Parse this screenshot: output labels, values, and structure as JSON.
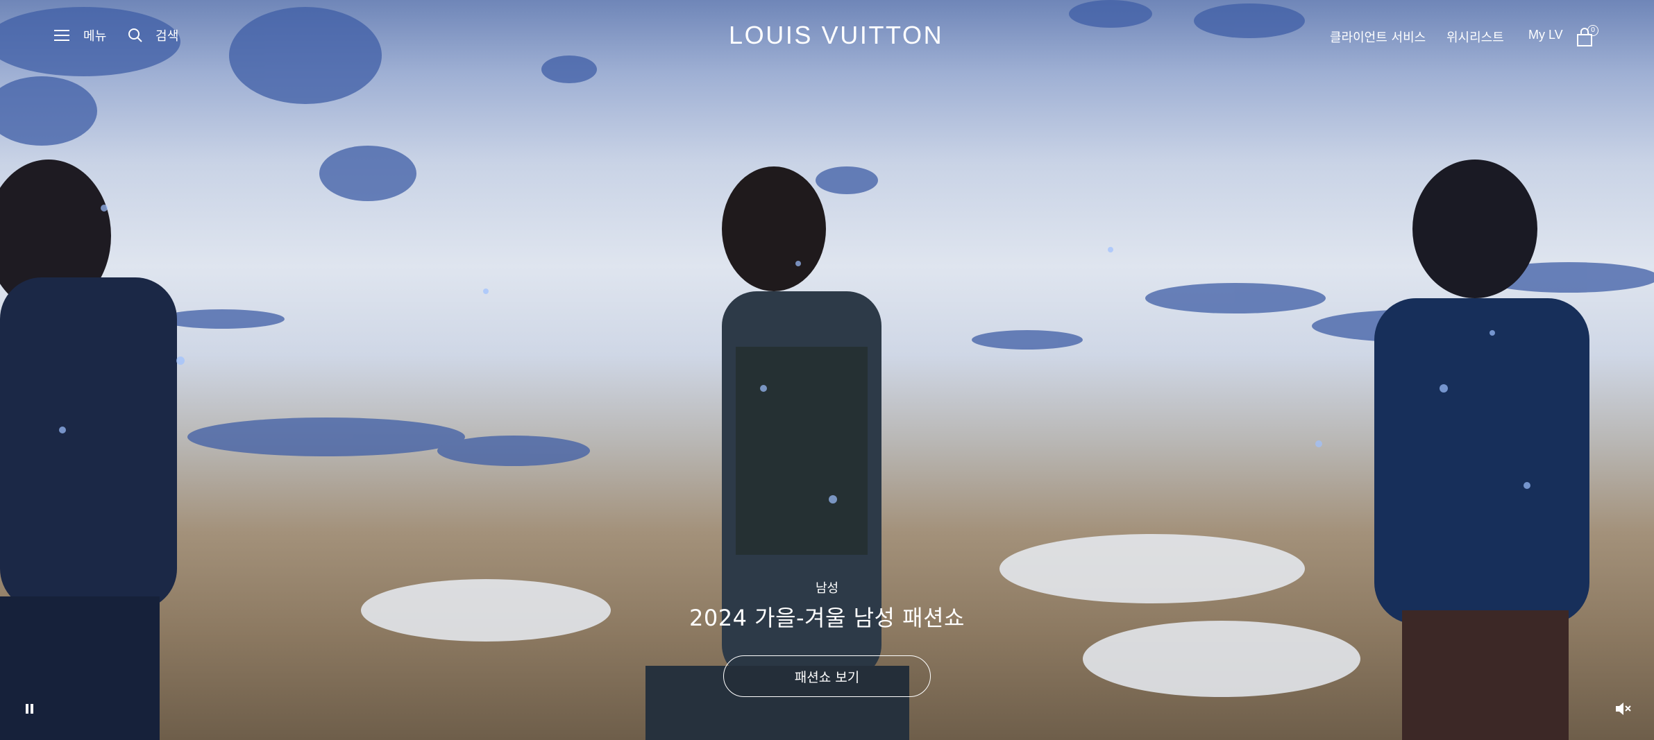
{
  "header": {
    "menu_label": "메뉴",
    "search_label": "검색",
    "logo_text": "LOUIS VUITTON",
    "client_services_label": "클라이언트 서비스",
    "wishlist_label": "위시리스트",
    "my_lv_label": "My LV",
    "bag_count": "0"
  },
  "hero": {
    "eyebrow": "남성",
    "title": "2024 가을-겨울 남성 패션쇼",
    "cta_label": "패션쇼 보기"
  },
  "video_controls": {
    "pause_icon": "pause-icon",
    "mute_icon": "muted-speaker-icon"
  },
  "colors": {
    "text": "#ffffff",
    "sky_blue": "#6f86b8",
    "snow": "#dfe5ef",
    "grass": "#a3917a"
  }
}
